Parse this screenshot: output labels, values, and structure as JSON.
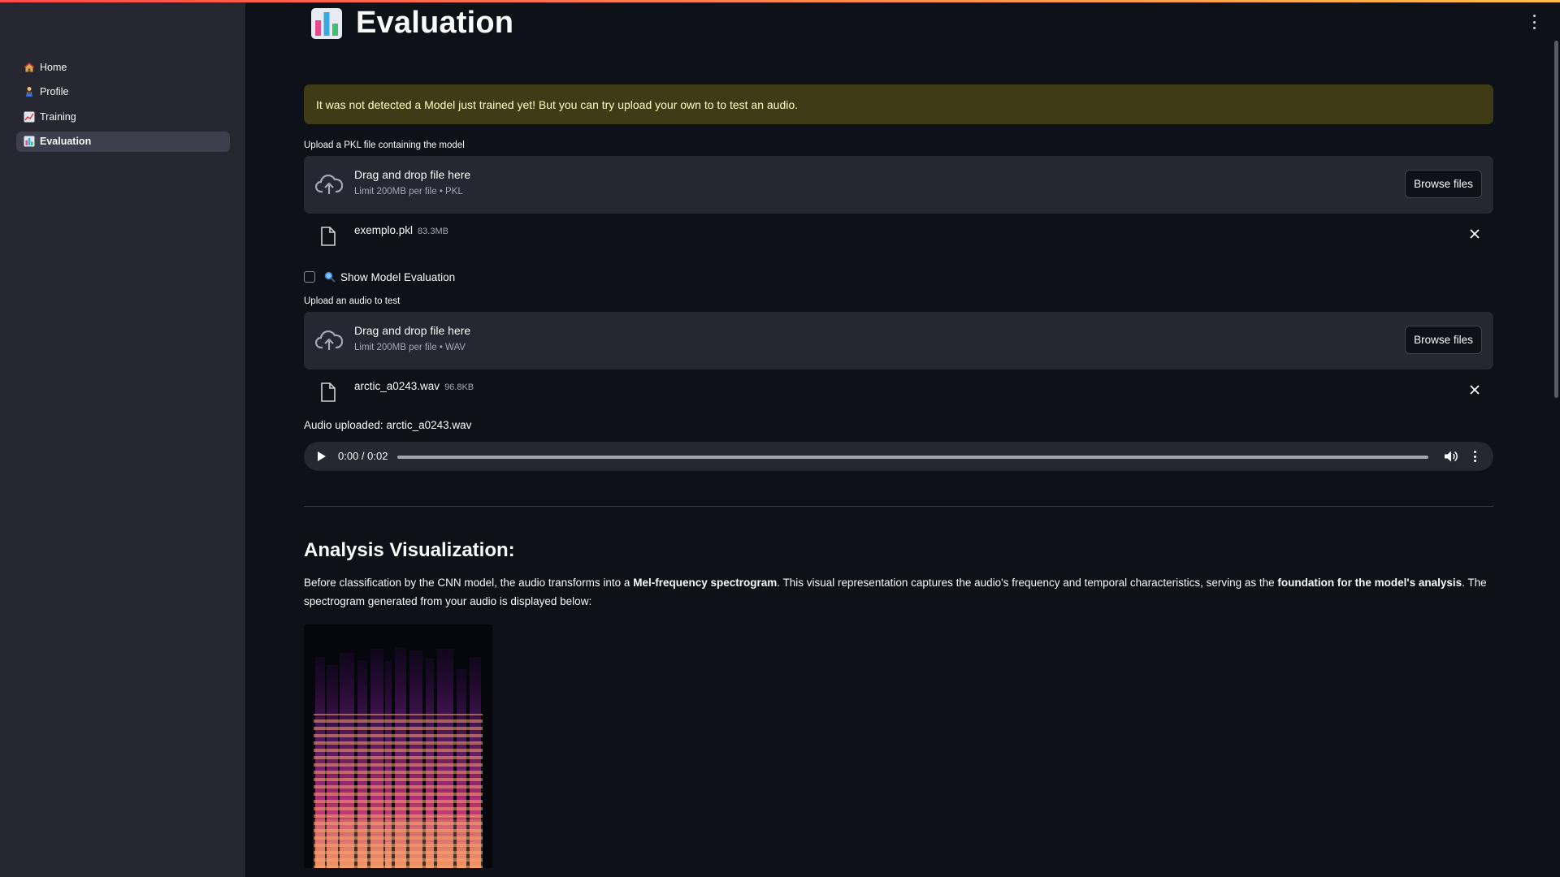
{
  "sidebar": {
    "items": [
      {
        "label": "Home",
        "icon": "house-icon"
      },
      {
        "label": "Profile",
        "icon": "person-icon"
      },
      {
        "label": "Training",
        "icon": "chart-up-icon"
      },
      {
        "label": "Evaluation",
        "icon": "bar-chart-icon",
        "active": true
      }
    ]
  },
  "header": {
    "title": "Evaluation",
    "icon": "bar-chart-icon"
  },
  "warning": {
    "text": "It was not detected a Model just trained yet! But you can try upload your own to to test an audio."
  },
  "model_upload": {
    "label": "Upload a PKL file containing the model",
    "drop_title": "Drag and drop file here",
    "limit": "Limit 200MB per file • PKL",
    "browse_label": "Browse files",
    "file_name": "exemplo.pkl",
    "file_size": "83.3MB"
  },
  "show_eval": {
    "label": "Show Model Evaluation",
    "checked": false
  },
  "audio_upload": {
    "label": "Upload an audio to test",
    "drop_title": "Drag and drop file here",
    "limit": "Limit 200MB per file • WAV",
    "browse_label": "Browse files",
    "file_name": "arctic_a0243.wav",
    "file_size": "96.8KB"
  },
  "audio_status": "Audio uploaded: arctic_a0243.wav",
  "player": {
    "time": "0:00 / 0:02",
    "progress": 0.0
  },
  "analysis": {
    "title": "Analysis Visualization:",
    "p1": "Before classification by the CNN model, the audio transforms into a ",
    "b1": "Mel-frequency spectrogram",
    "p2": ". This visual representation captures the audio's frequency and temporal characteristics, serving as the ",
    "b2": "foundation for the model's analysis",
    "p3": ". The spectrogram generated from your audio is displayed below:"
  },
  "colors": {
    "background": "#0e1117",
    "sidebar": "#262730",
    "warning_bg": "#3e3b16",
    "warning_text": "#ffffc2",
    "accent_red": "#ff4b4b",
    "accent_yellow": "#ffbd45"
  }
}
